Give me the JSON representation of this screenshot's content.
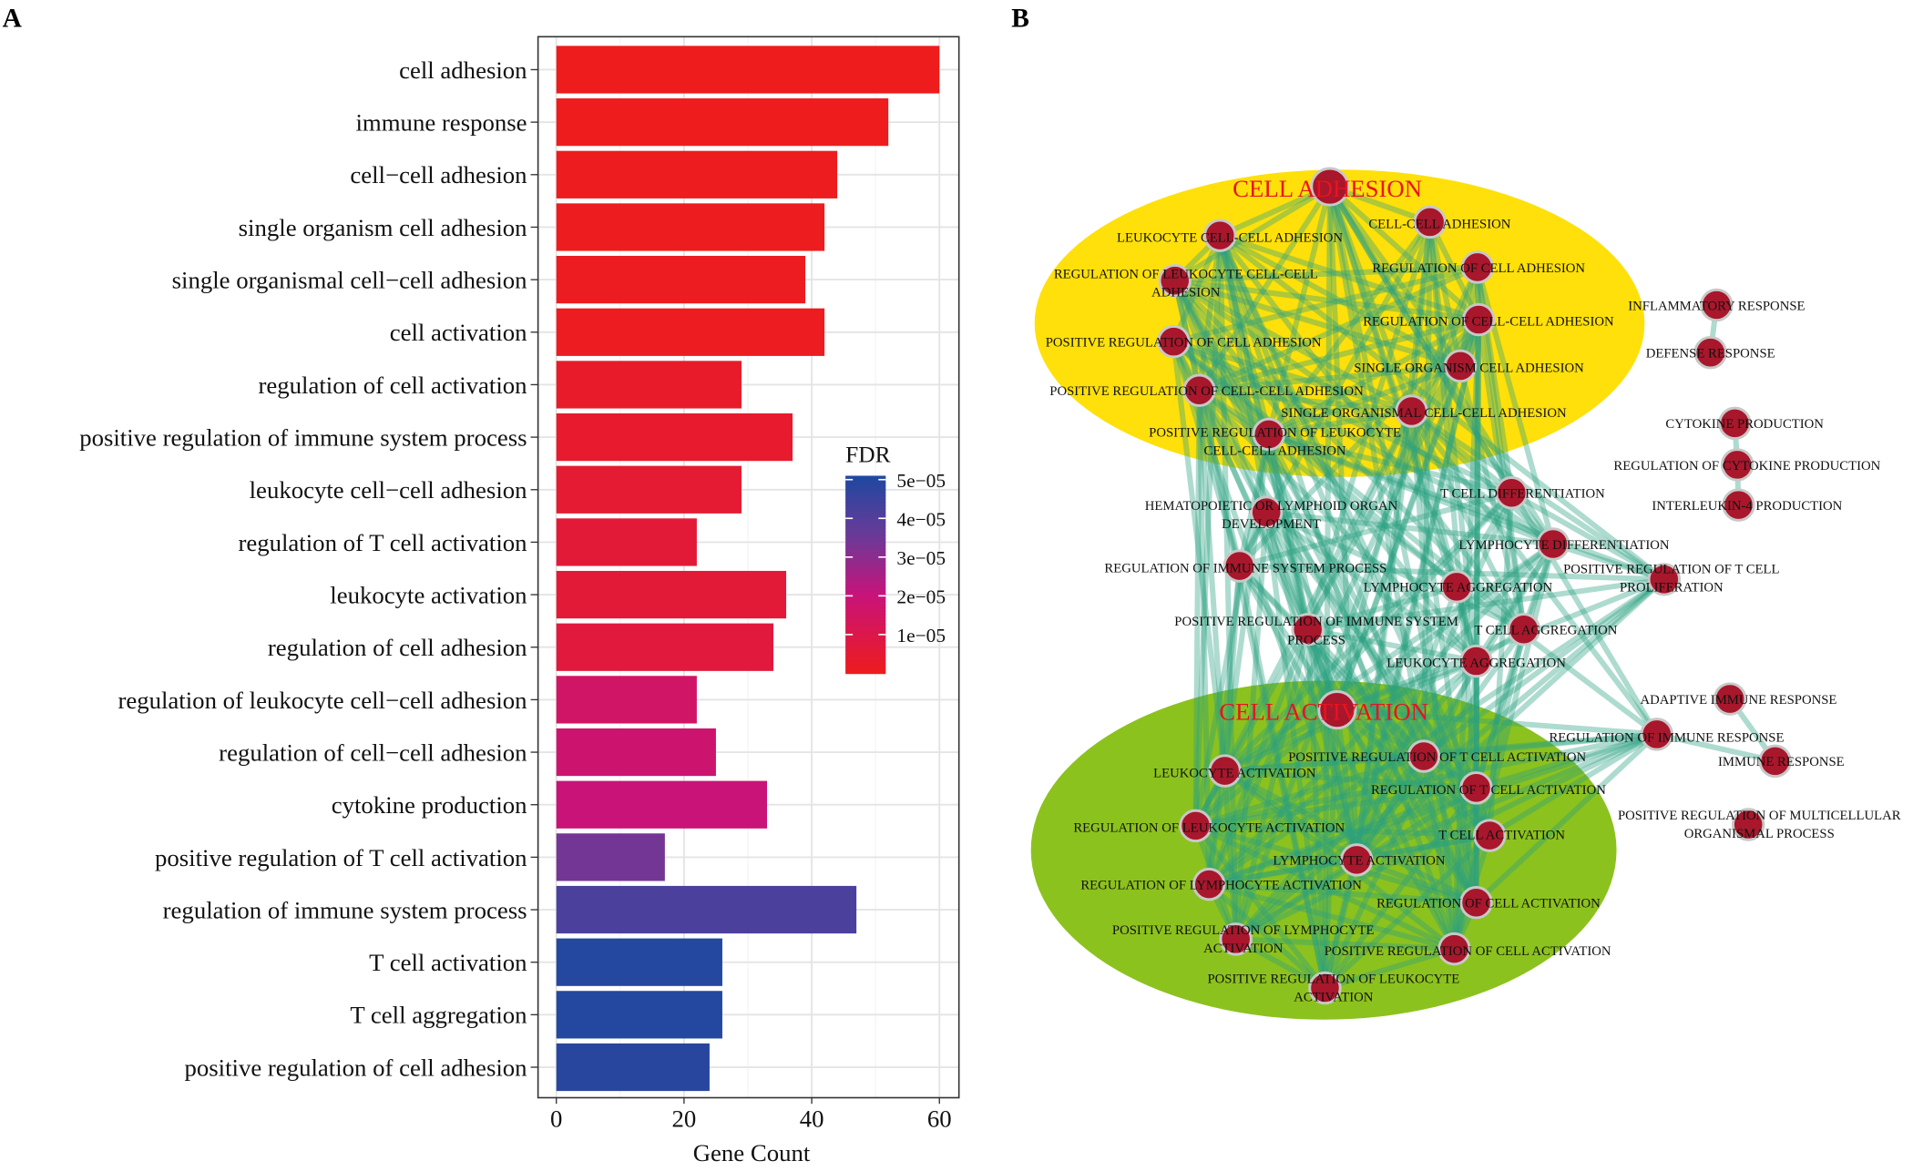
{
  "panel_a_letter": "A",
  "panel_b_letter": "B",
  "chart_data": {
    "type": "bar",
    "orientation": "horizontal",
    "xlabel": "Gene Count",
    "ylabel": "",
    "xlim": [
      0,
      62
    ],
    "xticks": [
      0,
      20,
      40,
      60
    ],
    "grid": true,
    "legend": {
      "title": "FDR",
      "placement": "right-inside",
      "range": [
        0,
        5.1e-05
      ],
      "ticks": [
        {
          "value": 5e-05,
          "label": "5e−05"
        },
        {
          "value": 4e-05,
          "label": "4e−05"
        },
        {
          "value": 3e-05,
          "label": "3e−05"
        },
        {
          "value": 2e-05,
          "label": "2e−05"
        },
        {
          "value": 1e-05,
          "label": "1e−05"
        }
      ],
      "colors": {
        "low": "#EE1C1C",
        "mid": "#C8137A",
        "midhigh": "#6A3A98",
        "high": "#1F48A0"
      }
    },
    "categories": [
      "cell adhesion",
      "immune response",
      "cell−cell adhesion",
      "single organism cell adhesion",
      "single organismal cell−cell adhesion",
      "cell activation",
      "regulation of cell activation",
      "positive regulation of immune system process",
      "leukocyte cell−cell adhesion",
      "regulation of T cell activation",
      "leukocyte activation",
      "regulation of cell adhesion",
      "regulation of leukocyte cell−cell adhesion",
      "regulation of cell−cell adhesion",
      "cytokine production",
      "positive regulation of T cell activation",
      "regulation of immune system process",
      "T cell activation",
      "T cell aggregation",
      "positive regulation of cell adhesion"
    ],
    "values": [
      60,
      52,
      44,
      42,
      39,
      42,
      29,
      37,
      29,
      22,
      36,
      34,
      22,
      25,
      33,
      17,
      47,
      26,
      26,
      24
    ],
    "fdr": [
      1e-07,
      2e-07,
      5e-07,
      6e-07,
      8e-07,
      1e-06,
      3e-06,
      4e-06,
      5e-06,
      6e-06,
      6e-06,
      7e-06,
      1.6e-05,
      1.8e-05,
      2e-05,
      3.4e-05,
      4.2e-05,
      5e-05,
      5e-05,
      4.9e-05
    ]
  },
  "network": {
    "colors": {
      "cluster_adhesion": "#FFE00A",
      "cluster_activation": "#8CC21E",
      "node": "#A8172B",
      "node_border": "#C8C8C8",
      "edge": "#2AA080",
      "cluster_label": "#E8141E"
    },
    "clusters": [
      {
        "label": "CELL ADHESION"
      },
      {
        "label": "CELL ACTIVATION"
      }
    ],
    "nodes": [
      {
        "label": [
          ""
        ]
      },
      {
        "label": [
          "LEUKOCYTE CELL-CELL ADHESION"
        ]
      },
      {
        "label": [
          "CELL-CELL ADHESION"
        ]
      },
      {
        "label": [
          "REGULATION OF CELL ADHESION"
        ]
      },
      {
        "label": [
          "REGULATION OF LEUKOCYTE CELL-CELL",
          "ADHESION"
        ]
      },
      {
        "label": [
          "REGULATION OF CELL-CELL ADHESION"
        ]
      },
      {
        "label": [
          "POSITIVE REGULATION OF CELL ADHESION"
        ]
      },
      {
        "label": [
          "SINGLE ORGANISM CELL ADHESION"
        ]
      },
      {
        "label": [
          "POSITIVE REGULATION OF CELL-CELL ADHESION"
        ]
      },
      {
        "label": [
          "SINGLE ORGANISMAL CELL-CELL ADHESION"
        ]
      },
      {
        "label": [
          "POSITIVE REGULATION OF LEUKOCYTE",
          "CELL-CELL ADHESION"
        ]
      },
      {
        "label": [
          "INFLAMMATORY RESPONSE"
        ]
      },
      {
        "label": [
          "DEFENSE RESPONSE"
        ]
      },
      {
        "label": [
          "CYTOKINE PRODUCTION"
        ]
      },
      {
        "label": [
          "REGULATION OF CYTOKINE PRODUCTION"
        ]
      },
      {
        "label": [
          "INTERLEUKIN-4 PRODUCTION"
        ]
      },
      {
        "label": [
          "T CELL DIFFERENTIATION"
        ]
      },
      {
        "label": [
          "HEMATOPOIETIC OR LYMPHOID ORGAN",
          "DEVELOPMENT"
        ]
      },
      {
        "label": [
          "LYMPHOCYTE DIFFERENTIATION"
        ]
      },
      {
        "label": [
          "REGULATION OF IMMUNE SYSTEM PROCESS"
        ]
      },
      {
        "label": [
          "POSITIVE REGULATION OF T CELL",
          "PROLIFERATION"
        ]
      },
      {
        "label": [
          "LYMPHOCYTE AGGREGATION"
        ]
      },
      {
        "label": [
          "POSITIVE REGULATION OF IMMUNE SYSTEM",
          "PROCESS"
        ]
      },
      {
        "label": [
          "T CELL AGGREGATION"
        ]
      },
      {
        "label": [
          "LEUKOCYTE AGGREGATION"
        ]
      },
      {
        "label": [
          ""
        ]
      },
      {
        "label": [
          "ADAPTIVE IMMUNE RESPONSE"
        ]
      },
      {
        "label": [
          "REGULATION OF IMMUNE RESPONSE"
        ]
      },
      {
        "label": [
          "IMMUNE RESPONSE"
        ]
      },
      {
        "label": [
          "POSITIVE REGULATION OF T CELL ACTIVATION"
        ]
      },
      {
        "label": [
          "LEUKOCYTE ACTIVATION"
        ]
      },
      {
        "label": [
          "REGULATION OF T CELL ACTIVATION"
        ]
      },
      {
        "label": [
          "POSITIVE REGULATION OF MULTICELLULAR",
          "ORGANISMAL PROCESS"
        ]
      },
      {
        "label": [
          "REGULATION OF LEUKOCYTE ACTIVATION"
        ]
      },
      {
        "label": [
          "T CELL ACTIVATION"
        ]
      },
      {
        "label": [
          "LYMPHOCYTE ACTIVATION"
        ]
      },
      {
        "label": [
          "REGULATION OF LYMPHOCYTE ACTIVATION"
        ]
      },
      {
        "label": [
          "REGULATION OF CELL ACTIVATION"
        ]
      },
      {
        "label": [
          "POSITIVE REGULATION OF LYMPHOCYTE",
          "ACTIVATION"
        ]
      },
      {
        "label": [
          "POSITIVE REGULATION OF CELL ACTIVATION"
        ]
      },
      {
        "label": [
          "POSITIVE REGULATION OF LEUKOCYTE",
          "ACTIVATION"
        ]
      }
    ]
  }
}
